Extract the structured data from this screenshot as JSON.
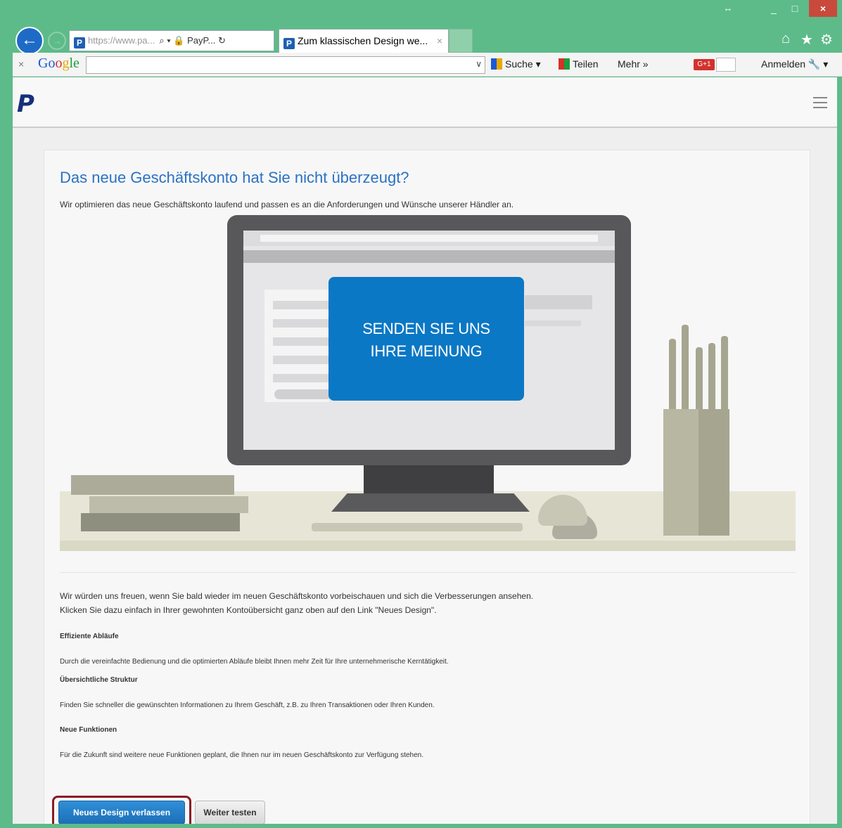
{
  "browser": {
    "address_url": "https://www.pa...",
    "address_suffix": "⌕ ▾ 🔒 PayP... ↻",
    "tab_title": "Zum klassischen Design we...",
    "close_tab": "×"
  },
  "google_toolbar": {
    "close": "×",
    "logo_parts": [
      "Go",
      "o",
      "g",
      "le"
    ],
    "suche_label": "Suche ▾",
    "teilen_label": "Teilen",
    "mehr_label": "Mehr »",
    "gplus_label": "G+1",
    "anmelden_label": "Anmelden 🔧 ▾"
  },
  "page": {
    "logo": "P",
    "title": "Das neue Geschäftskonto hat Sie nicht überzeugt?",
    "subtitle": "Wir optimieren das neue Geschäftskonto laufend und passen es an die Anforderungen und Wünsche unserer Händler an.",
    "illustration_cta_line1": "SENDEN SIE UNS",
    "illustration_cta_line2": "IHRE MEINUNG",
    "body_line1": "Wir würden uns freuen, wenn Sie bald wieder im neuen Geschäftskonto vorbeischauen und sich die Verbesserungen ansehen.",
    "body_line2": "Klicken Sie dazu einfach in Ihrer gewohnten Kontoübersicht ganz oben auf den Link \"Neues Design\".",
    "features": [
      {
        "heading": "Effiziente Abläufe",
        "text": "Durch die vereinfachte Bedienung und die optimierten Abläufe bleibt Ihnen mehr Zeit für Ihre unternehmerische Kerntätigkeit."
      },
      {
        "heading": "Übersichtliche Struktur",
        "text": "Finden Sie schneller die gewünschten Informationen zu Ihrem Geschäft, z.B. zu Ihren Transaktionen oder Ihren Kunden."
      },
      {
        "heading": "Neue Funktionen",
        "text": "Für die Zukunft sind weitere neue Funktionen geplant, die Ihnen nur im neuen Geschäftskonto zur Verfügung stehen."
      }
    ],
    "primary_button": "Neues Design verlassen",
    "secondary_button": "Weiter testen"
  },
  "colors": {
    "window_frame": "#5dbb8a",
    "paypal_blue": "#16307a",
    "title_blue": "#2b72c4",
    "cta_blue": "#0b78c5",
    "focus_ring": "#8b1a24"
  }
}
